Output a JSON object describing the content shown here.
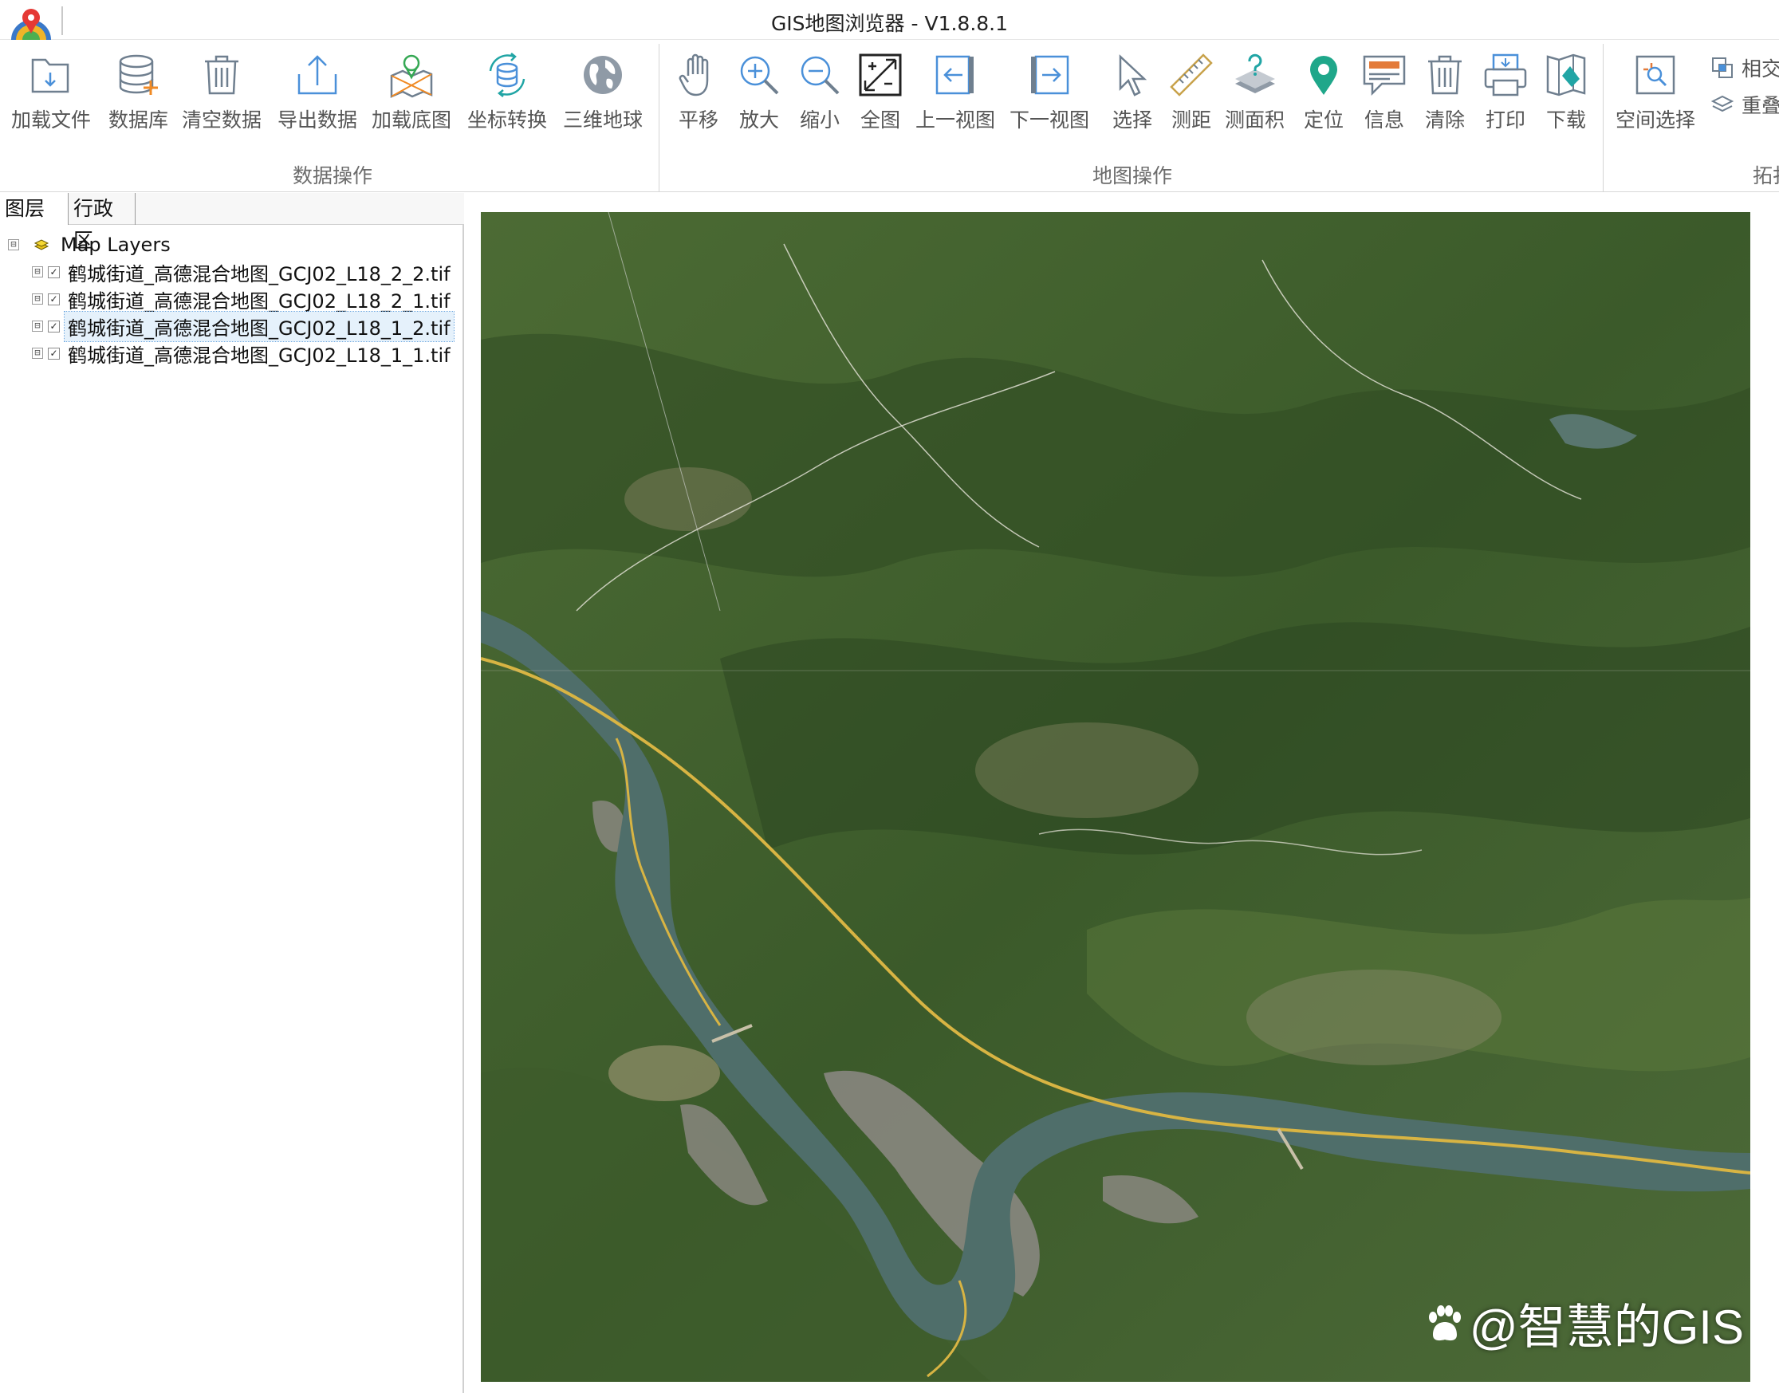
{
  "window": {
    "title": "GIS地图浏览器 - V1.8.8.1"
  },
  "ribbon": {
    "groups": {
      "data_ops": "数据操作",
      "map_ops": "地图操作",
      "topology": "拓扑"
    },
    "data_buttons": {
      "load_file": "加载文件",
      "database": "数据库",
      "clear_data": "清空数据",
      "export_data": "导出数据",
      "load_basemap": "加载底图",
      "coord_transform": "坐标转换",
      "globe_3d": "三维地球"
    },
    "map_buttons": {
      "pan": "平移",
      "zoom_in": "放大",
      "zoom_out": "缩小",
      "full_extent": "全图",
      "prev_view": "上一视图",
      "next_view": "下一视图",
      "select": "选择",
      "measure_distance": "测距",
      "measure_area": "测面积",
      "locate": "定位",
      "info": "信息",
      "clear": "清除",
      "print": "打印",
      "download": "下载"
    },
    "topology_buttons": {
      "spatial_select": "空间选择",
      "intersect": "相交",
      "overlay": "重叠"
    }
  },
  "left_panel": {
    "tabs": [
      "图层",
      "行政区"
    ],
    "tree": {
      "root_label": "Map Layers",
      "layers": [
        {
          "name": "鹤城街道_高德混合地图_GCJ02_L18_2_2.tif",
          "checked": true,
          "check_glyph": "✓",
          "expander": "⊟"
        },
        {
          "name": "鹤城街道_高德混合地图_GCJ02_L18_2_1.tif",
          "checked": true,
          "check_glyph": "✓",
          "expander": "⊟"
        },
        {
          "name": "鹤城街道_高德混合地图_GCJ02_L18_1_2.tif",
          "checked": true,
          "check_glyph": "✓",
          "expander": "⊟",
          "selected": true
        },
        {
          "name": "鹤城街道_高德混合地图_GCJ02_L18_1_1.tif",
          "checked": true,
          "check_glyph": "✓",
          "expander": "⊟"
        }
      ],
      "root_expander": "⊟"
    }
  },
  "map": {
    "watermark": "@智慧的GIS",
    "colors": {
      "forest": "#3c5a2c",
      "river": "#4f6e6a",
      "road": "#d8b443",
      "urban": "#8d8a85"
    }
  },
  "icons": [
    "app-logo-icon",
    "folder-load-icon",
    "database-icon",
    "trash-icon",
    "export-icon",
    "map-pin-layer-icon",
    "coord-transform-icon",
    "globe-icon",
    "hand-pan-icon",
    "zoom-in-icon",
    "zoom-out-icon",
    "full-extent-icon",
    "prev-view-icon",
    "next-view-icon",
    "cursor-select-icon",
    "ruler-icon",
    "area-measure-icon",
    "location-pin-icon",
    "message-icon",
    "clear-trash-icon",
    "printer-icon",
    "download-map-icon",
    "spatial-select-icon",
    "intersect-icon",
    "overlay-icon",
    "layers-icon",
    "paw-icon"
  ]
}
